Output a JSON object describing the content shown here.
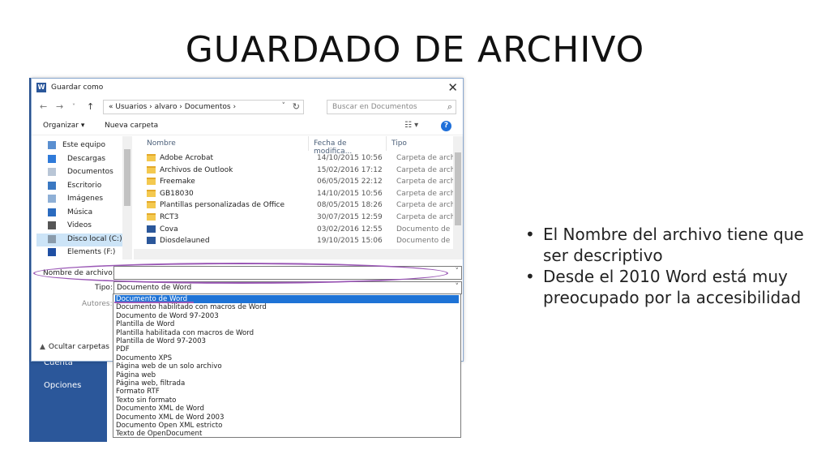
{
  "slide": {
    "title": "GUARDADO DE ARCHIVO",
    "bullets": [
      "El Nombre del archivo tiene que ser descriptivo",
      "Desde el 2010 Word está muy preocupado por la accesibilidad"
    ]
  },
  "backstage": {
    "items": [
      "Cuenta",
      "Opciones"
    ]
  },
  "dialog": {
    "title": "Guardar como",
    "address": {
      "crumbs": "« Usuarios  ›  alvaro  ›  Documentos  ›"
    },
    "search_placeholder": "Buscar en Documentos",
    "toolbar": {
      "organize": "Organizar ▾",
      "new_folder": "Nueva carpeta"
    },
    "nav_items": [
      {
        "label": "Este equipo",
        "icon": "computer-icon"
      },
      {
        "label": "Descargas",
        "icon": "download-icon"
      },
      {
        "label": "Documentos",
        "icon": "documents-icon"
      },
      {
        "label": "Escritorio",
        "icon": "desktop-icon"
      },
      {
        "label": "Imágenes",
        "icon": "images-icon"
      },
      {
        "label": "Música",
        "icon": "music-icon"
      },
      {
        "label": "Videos",
        "icon": "videos-icon"
      },
      {
        "label": "Disco local (C:)",
        "icon": "drive-icon",
        "selected": true
      },
      {
        "label": "Elements (F:)",
        "icon": "usb-drive-icon"
      }
    ],
    "columns": {
      "name": "Nombre",
      "date": "Fecha de modifica...",
      "type": "Tipo"
    },
    "files": [
      {
        "name": "Adobe Acrobat",
        "date": "14/10/2015 10:56",
        "type": "Carpeta de archivos",
        "kind": "folder"
      },
      {
        "name": "Archivos de Outlook",
        "date": "15/02/2016 17:12",
        "type": "Carpeta de archivos",
        "kind": "folder"
      },
      {
        "name": "Freemake",
        "date": "06/05/2015 22:12",
        "type": "Carpeta de archivos",
        "kind": "folder"
      },
      {
        "name": "GB18030",
        "date": "14/10/2015 10:56",
        "type": "Carpeta de archivos",
        "kind": "folder"
      },
      {
        "name": "Plantillas personalizadas de Office",
        "date": "08/05/2015 18:26",
        "type": "Carpeta de archivos",
        "kind": "folder"
      },
      {
        "name": "RCT3",
        "date": "30/07/2015 12:59",
        "type": "Carpeta de archivos",
        "kind": "folder"
      },
      {
        "name": "Cova",
        "date": "03/02/2016 12:55",
        "type": "Documento de Microsoft",
        "kind": "doc"
      },
      {
        "name": "Diosdelauned",
        "date": "19/10/2015 15:06",
        "type": "Documento de Microsoft",
        "kind": "doc"
      }
    ],
    "filename_label": "Nombre de archivo:",
    "filename_value": "",
    "type_label": "Tipo:",
    "type_value": "Documento de Word",
    "authors_label": "Autores:",
    "hide_folders": "Ocultar carpetas",
    "type_options": [
      "Documento de Word",
      "Documento habilitado con macros de Word",
      "Documento de Word 97-2003",
      "Plantilla de Word",
      "Plantilla habilitada con macros de Word",
      "Plantilla de Word 97-2003",
      "PDF",
      "Documento XPS",
      "Página web de un solo archivo",
      "Página web",
      "Página web, filtrada",
      "Formato RTF",
      "Texto sin formato",
      "Documento XML de Word",
      "Documento XML de Word 2003",
      "Documento Open XML estricto",
      "Texto de OpenDocument"
    ],
    "selected_type_index": 0
  },
  "colors": {
    "word_blue": "#2b579a",
    "highlight_oval": "#9b59b6",
    "selection": "#1e73d6"
  }
}
